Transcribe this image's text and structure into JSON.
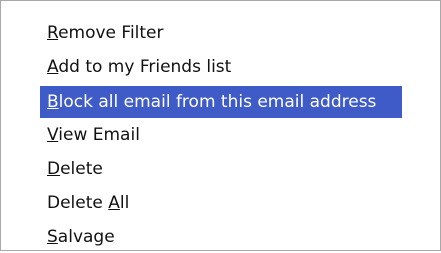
{
  "context_menu": {
    "items": [
      {
        "label": "Remove Filter",
        "mnemonic_index": 0,
        "highlighted": false
      },
      {
        "label": "Add to my Friends list",
        "mnemonic_index": 0,
        "highlighted": false
      },
      {
        "label": "Block all email from this email address",
        "mnemonic_index": 0,
        "highlighted": true
      },
      {
        "label": "View Email",
        "mnemonic_index": 0,
        "highlighted": false
      },
      {
        "label": "Delete",
        "mnemonic_index": 0,
        "highlighted": false
      },
      {
        "label": "Delete All",
        "mnemonic_index": 7,
        "highlighted": false
      },
      {
        "label": "Salvage",
        "mnemonic_index": 0,
        "highlighted": false
      }
    ],
    "highlight_color": "#3f5bc7",
    "text_color": "#111111",
    "highlight_text_color": "#ffffff"
  }
}
